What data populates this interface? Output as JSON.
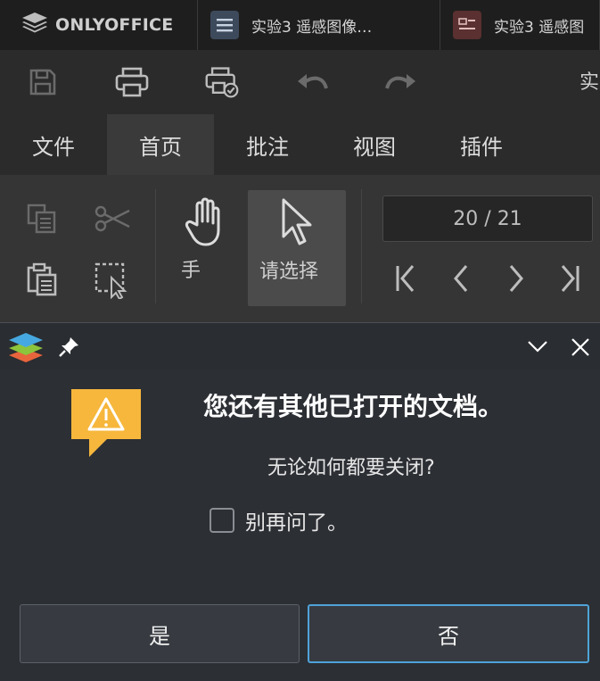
{
  "app": {
    "brand": "ONLYOFFICE",
    "tabs": [
      {
        "label": "实验3 遥感图像…",
        "icon": "document-icon"
      },
      {
        "label": "实验3 遥感图",
        "icon": "presentation-icon"
      }
    ]
  },
  "quickbar": {
    "icons": [
      "save-icon",
      "print-icon",
      "quick-print-icon",
      "undo-icon",
      "redo-icon"
    ],
    "doc_title_partial": "实"
  },
  "menu": {
    "items": [
      "文件",
      "首页",
      "批注",
      "视图",
      "插件"
    ],
    "active_index": 1
  },
  "ribbon": {
    "hand_label": "手",
    "select_label": "请选择",
    "page_indicator": "20 / 21"
  },
  "dialog": {
    "headline": "您还有其他已打开的文档。",
    "question": "无论如何都要关闭?",
    "checkbox_label": "别再问了。",
    "checkbox_checked": false,
    "yes_label": "是",
    "no_label": "否"
  },
  "colors": {
    "accent_focus": "#4fa3d8",
    "warning": "#f6b73c"
  }
}
